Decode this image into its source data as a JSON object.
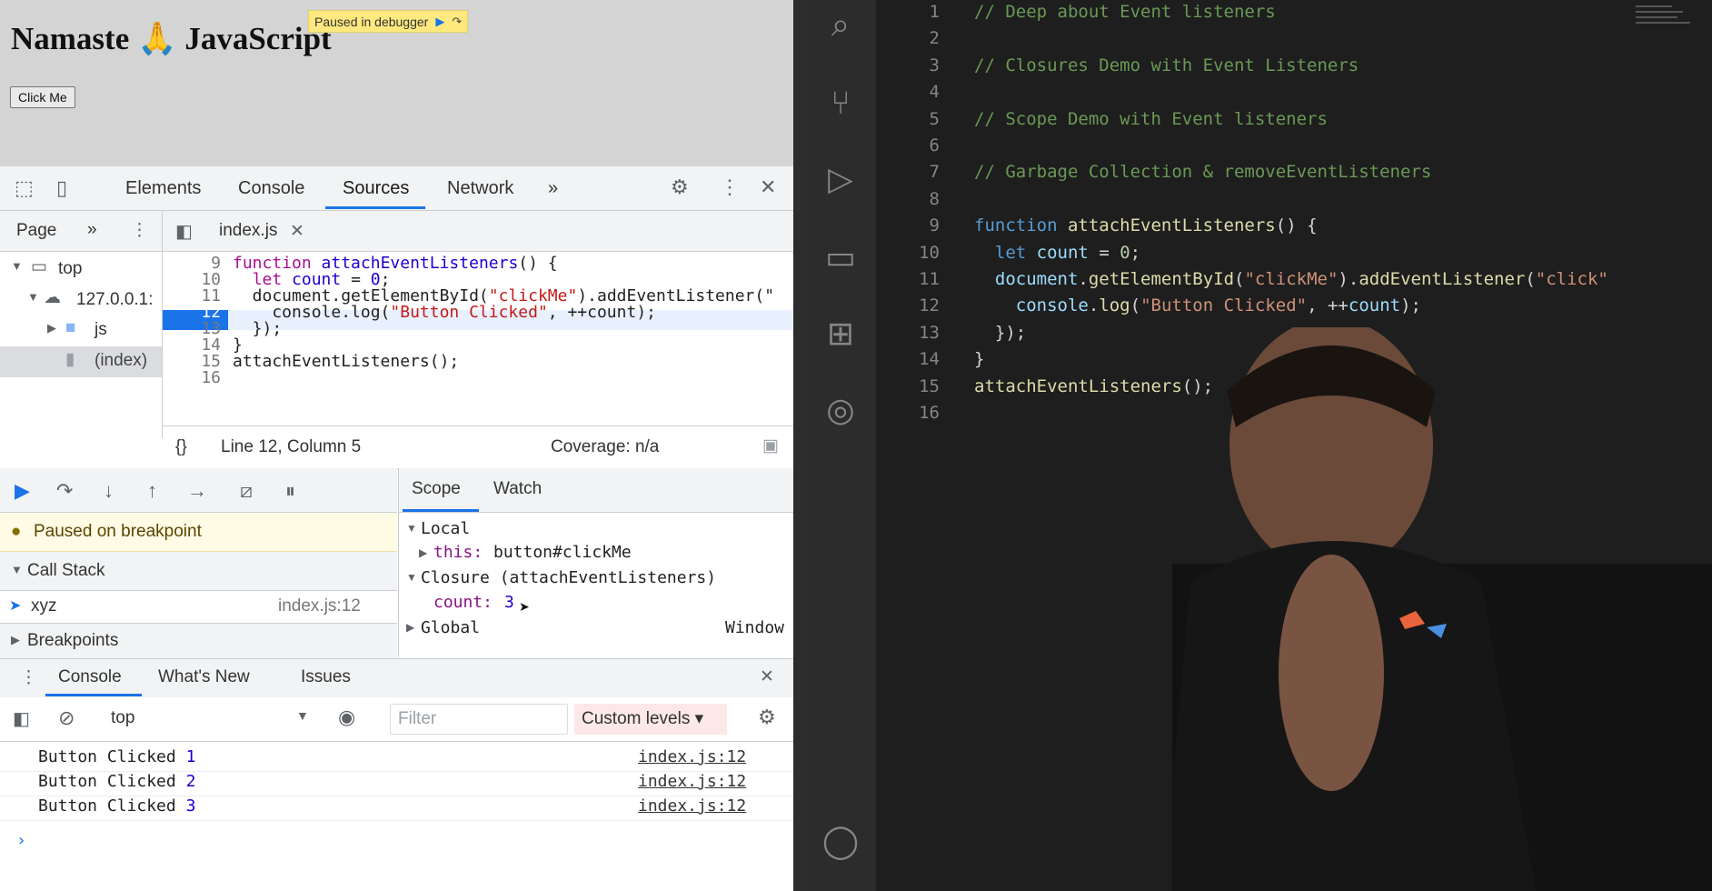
{
  "browser": {
    "heading": "Namaste 🙏 JavaScript",
    "paused_badge": "Paused in debugger",
    "button_label": "Click Me"
  },
  "devtools": {
    "tabs": [
      "Elements",
      "Console",
      "Sources",
      "Network"
    ],
    "active_tab": "Sources",
    "more": "»",
    "navigator": {
      "tab": "Page",
      "more": "»",
      "tree": [
        "top",
        "127.0.0.1:",
        "js",
        "(index)"
      ]
    },
    "editor_tab": "index.js",
    "code_lines": [
      {
        "num": "9",
        "text": "function attachEventListeners() {"
      },
      {
        "num": "10",
        "text": "  let count = 0;"
      },
      {
        "num": "11",
        "text": "  document.getElementById(\"clickMe\").addEventListener(\""
      },
      {
        "num": "12",
        "text": "    console.log(\"Button Clicked\", ++count);"
      },
      {
        "num": "13",
        "text": "  });"
      },
      {
        "num": "14",
        "text": "}"
      },
      {
        "num": "15",
        "text": "attachEventListeners();"
      },
      {
        "num": "16",
        "text": ""
      }
    ],
    "status": {
      "braces": "{}",
      "position": "Line 12, Column 5",
      "coverage": "Coverage: n/a"
    },
    "paused_message": "Paused on breakpoint",
    "call_stack": {
      "header": "Call Stack",
      "frames": [
        {
          "name": "xyz",
          "location": "index.js:12"
        }
      ]
    },
    "breakpoints_header": "Breakpoints",
    "scope_tabs": [
      "Scope",
      "Watch"
    ],
    "scope": {
      "local": "Local",
      "this_label": "this:",
      "this_value": "button#clickMe",
      "closure": "Closure (attachEventListeners)",
      "count_label": "count:",
      "count_value": "3",
      "global": "Global",
      "global_value": "Window"
    },
    "drawer_tabs": [
      "Console",
      "What's New",
      "Issues"
    ],
    "console_toolbar": {
      "context": "top",
      "filter_placeholder": "Filter",
      "levels": "Custom levels ▾"
    },
    "console_logs": [
      {
        "text": "Button Clicked",
        "value": "1",
        "link": "index.js:12"
      },
      {
        "text": "Button Clicked",
        "value": "2",
        "link": "index.js:12"
      },
      {
        "text": "Button Clicked",
        "value": "3",
        "link": "index.js:12"
      }
    ],
    "prompt": "›"
  },
  "vscode": {
    "lines": [
      {
        "num": "1",
        "text": "// Deep about Event listeners"
      },
      {
        "num": "2",
        "text": ""
      },
      {
        "num": "3",
        "text": "// Closures Demo with Event Listeners"
      },
      {
        "num": "4",
        "text": ""
      },
      {
        "num": "5",
        "text": "// Scope Demo with Event listeners"
      },
      {
        "num": "6",
        "text": ""
      },
      {
        "num": "7",
        "text": "// Garbage Collection & removeEventListeners"
      },
      {
        "num": "8",
        "text": ""
      },
      {
        "num": "9",
        "text": "function attachEventListeners() {"
      },
      {
        "num": "10",
        "text": "  let count = 0;"
      },
      {
        "num": "11",
        "text": "  document.getElementById(\"clickMe\").addEventListener(\"click\""
      },
      {
        "num": "12",
        "text": "    console.log(\"Button Clicked\", ++count);"
      },
      {
        "num": "13",
        "text": "  });"
      },
      {
        "num": "14",
        "text": "}"
      },
      {
        "num": "15",
        "text": "attachEventListeners();"
      },
      {
        "num": "16",
        "text": ""
      }
    ],
    "activity_icons": [
      "search-icon",
      "source-control-icon",
      "run-debug-icon",
      "remote-explorer-icon",
      "extensions-icon",
      "git-graph-icon",
      "account-icon"
    ]
  },
  "colors": {
    "devtools_accent": "#1a73e8",
    "vscode_bg": "#1e1e1e",
    "vscode_comment": "#6a9955",
    "vscode_keyword": "#569cd6"
  }
}
